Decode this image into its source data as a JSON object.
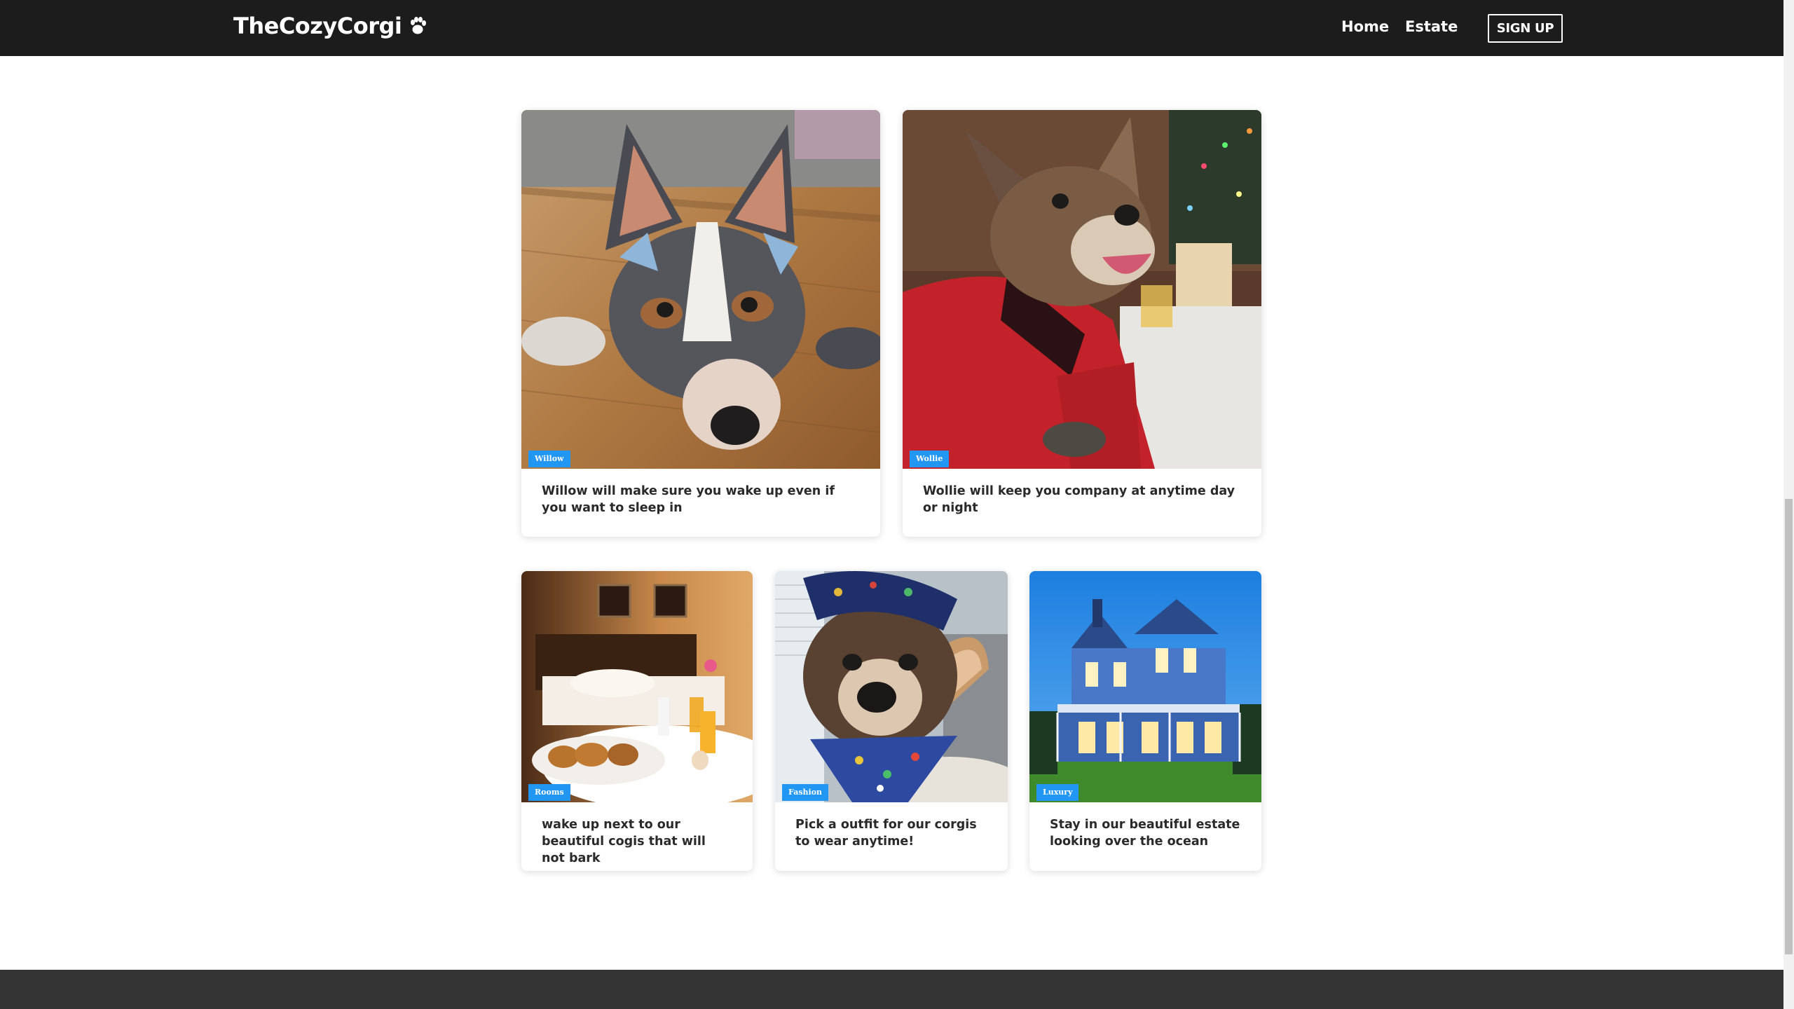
{
  "header": {
    "brand": "TheCozyCorgi",
    "brand_icon": "paw-icon",
    "nav": {
      "home": "Home",
      "estate": "Estate",
      "signup": "SIGN UP"
    }
  },
  "cards": [
    {
      "badge": "Willow",
      "text": "Willow will make sure you wake up even if you want to sleep in",
      "image": "corgi-willow-photo"
    },
    {
      "badge": "Wollie",
      "text": "Wollie will keep you company at anytime day or night",
      "image": "corgi-wollie-photo"
    },
    {
      "badge": "Rooms",
      "text": "wake up next to our beautiful cogis that will not bark",
      "image": "breakfast-bed-photo"
    },
    {
      "badge": "Fashion",
      "text": "Pick a outfit for our corgis to wear anytime!",
      "image": "corgi-bandana-photo"
    },
    {
      "badge": "Luxury",
      "text": "Stay in our beautiful estate looking over the ocean",
      "image": "blue-estate-photo"
    }
  ],
  "colors": {
    "navbar": "#1c1c1c",
    "badge": "#2196f3",
    "footer": "#333333"
  }
}
